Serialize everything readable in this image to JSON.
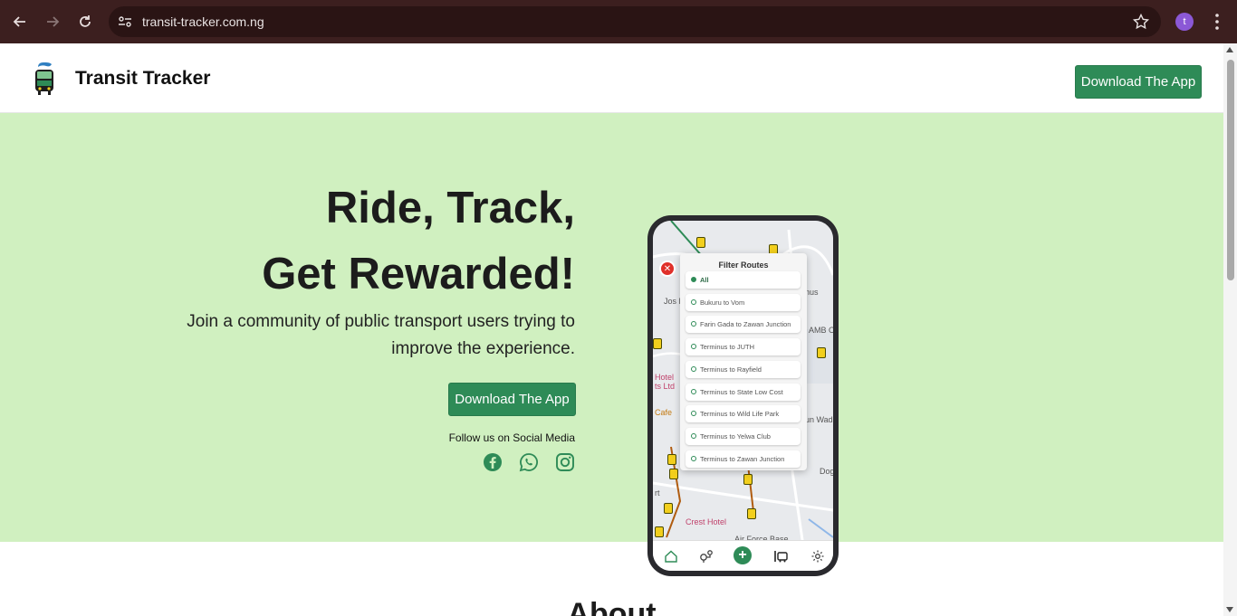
{
  "browser": {
    "url": "transit-tracker.com.ng",
    "profile_initial": "t"
  },
  "header": {
    "brand": "Transit Tracker",
    "download_label": "Download The App"
  },
  "hero": {
    "headline_line1": "Ride, Track,",
    "headline_line2": "Get Rewarded!",
    "tagline": "Join a community of public transport users trying to improve the experience.",
    "download_label": "Download The App",
    "follow_text": "Follow us on Social Media",
    "social": [
      "facebook-icon",
      "whatsapp-icon",
      "instagram-icon"
    ]
  },
  "phone": {
    "filter_title": "Filter Routes",
    "routes": [
      {
        "label": "All",
        "selected": true
      },
      {
        "label": "Bukuru to Vom",
        "selected": false
      },
      {
        "label": "Farin Gada to Zawan Junction",
        "selected": false
      },
      {
        "label": "Terminus to JUTH",
        "selected": false
      },
      {
        "label": "Terminus to Rayfield",
        "selected": false
      },
      {
        "label": "Terminus to State Low Cost",
        "selected": false
      },
      {
        "label": "Terminus to Wild Life Park",
        "selected": false
      },
      {
        "label": "Terminus to Yelwa Club",
        "selected": false
      },
      {
        "label": "Terminus to Zawan Junction",
        "selected": false
      }
    ],
    "map_labels": {
      "jos": "Jos N",
      "hotel": "Hotel",
      "ts_ltd": "ts Ltd",
      "cafe": "Cafe",
      "crest_hotel": "Crest Hotel",
      "air_force_base": "Air Force Base",
      "un_wad": "un Wad",
      "dog": "Dog",
      "nus": "nus",
      "amb_off": "AMB Offi",
      "rt": "rt"
    }
  },
  "about": {
    "title": "About"
  },
  "colors": {
    "brand_green": "#2e8b57",
    "hero_bg": "#d0f0c0",
    "chrome_bg": "#3c1f1f"
  }
}
